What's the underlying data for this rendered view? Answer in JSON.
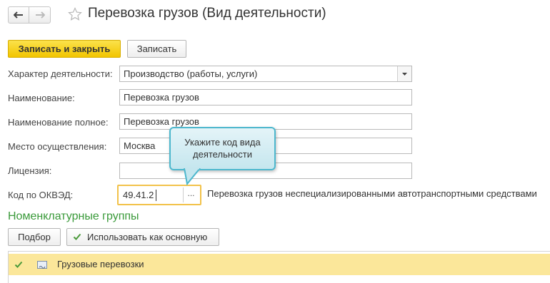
{
  "header": {
    "title": "Перевозка грузов (Вид деятельности)"
  },
  "toolbar": {
    "save_close_label": "Записать и закрыть",
    "save_label": "Записать"
  },
  "form": {
    "activity_type": {
      "label": "Характер деятельности:",
      "value": "Производство (работы, услуги)"
    },
    "name": {
      "label": "Наименование:",
      "value": "Перевозка грузов"
    },
    "full_name": {
      "label": "Наименование полное:",
      "value": "Перевозка грузов"
    },
    "location": {
      "label": "Место осуществления:",
      "value": "Москва"
    },
    "license": {
      "label": "Лицензия:",
      "value": ""
    },
    "okved": {
      "label": "Код по ОКВЭД:",
      "value": "49.41.2",
      "select_button": "...",
      "description": "Перевозка грузов неспециализированными автотранспортными средствами"
    }
  },
  "tooltip": {
    "line1": "Укажите код вида",
    "line2": "деятельности"
  },
  "nomenclature": {
    "title": "Номенклатурные группы",
    "pick_button": "Подбор",
    "use_as_main_button": "Использовать как основную",
    "rows": [
      {
        "name": "Грузовые перевозки",
        "main": true
      }
    ]
  },
  "colors": {
    "accent_yellow": "#f2c500",
    "section_green": "#3a9a3a",
    "tooltip_border": "#4cb7cd",
    "selected_row": "#fbe79a"
  },
  "icons": {
    "back": "arrow-left-icon",
    "forward": "arrow-right-icon",
    "favorite": "star-icon",
    "dropdown": "triangle-down-icon",
    "check": "checkmark-icon",
    "row": "list-item-icon"
  }
}
